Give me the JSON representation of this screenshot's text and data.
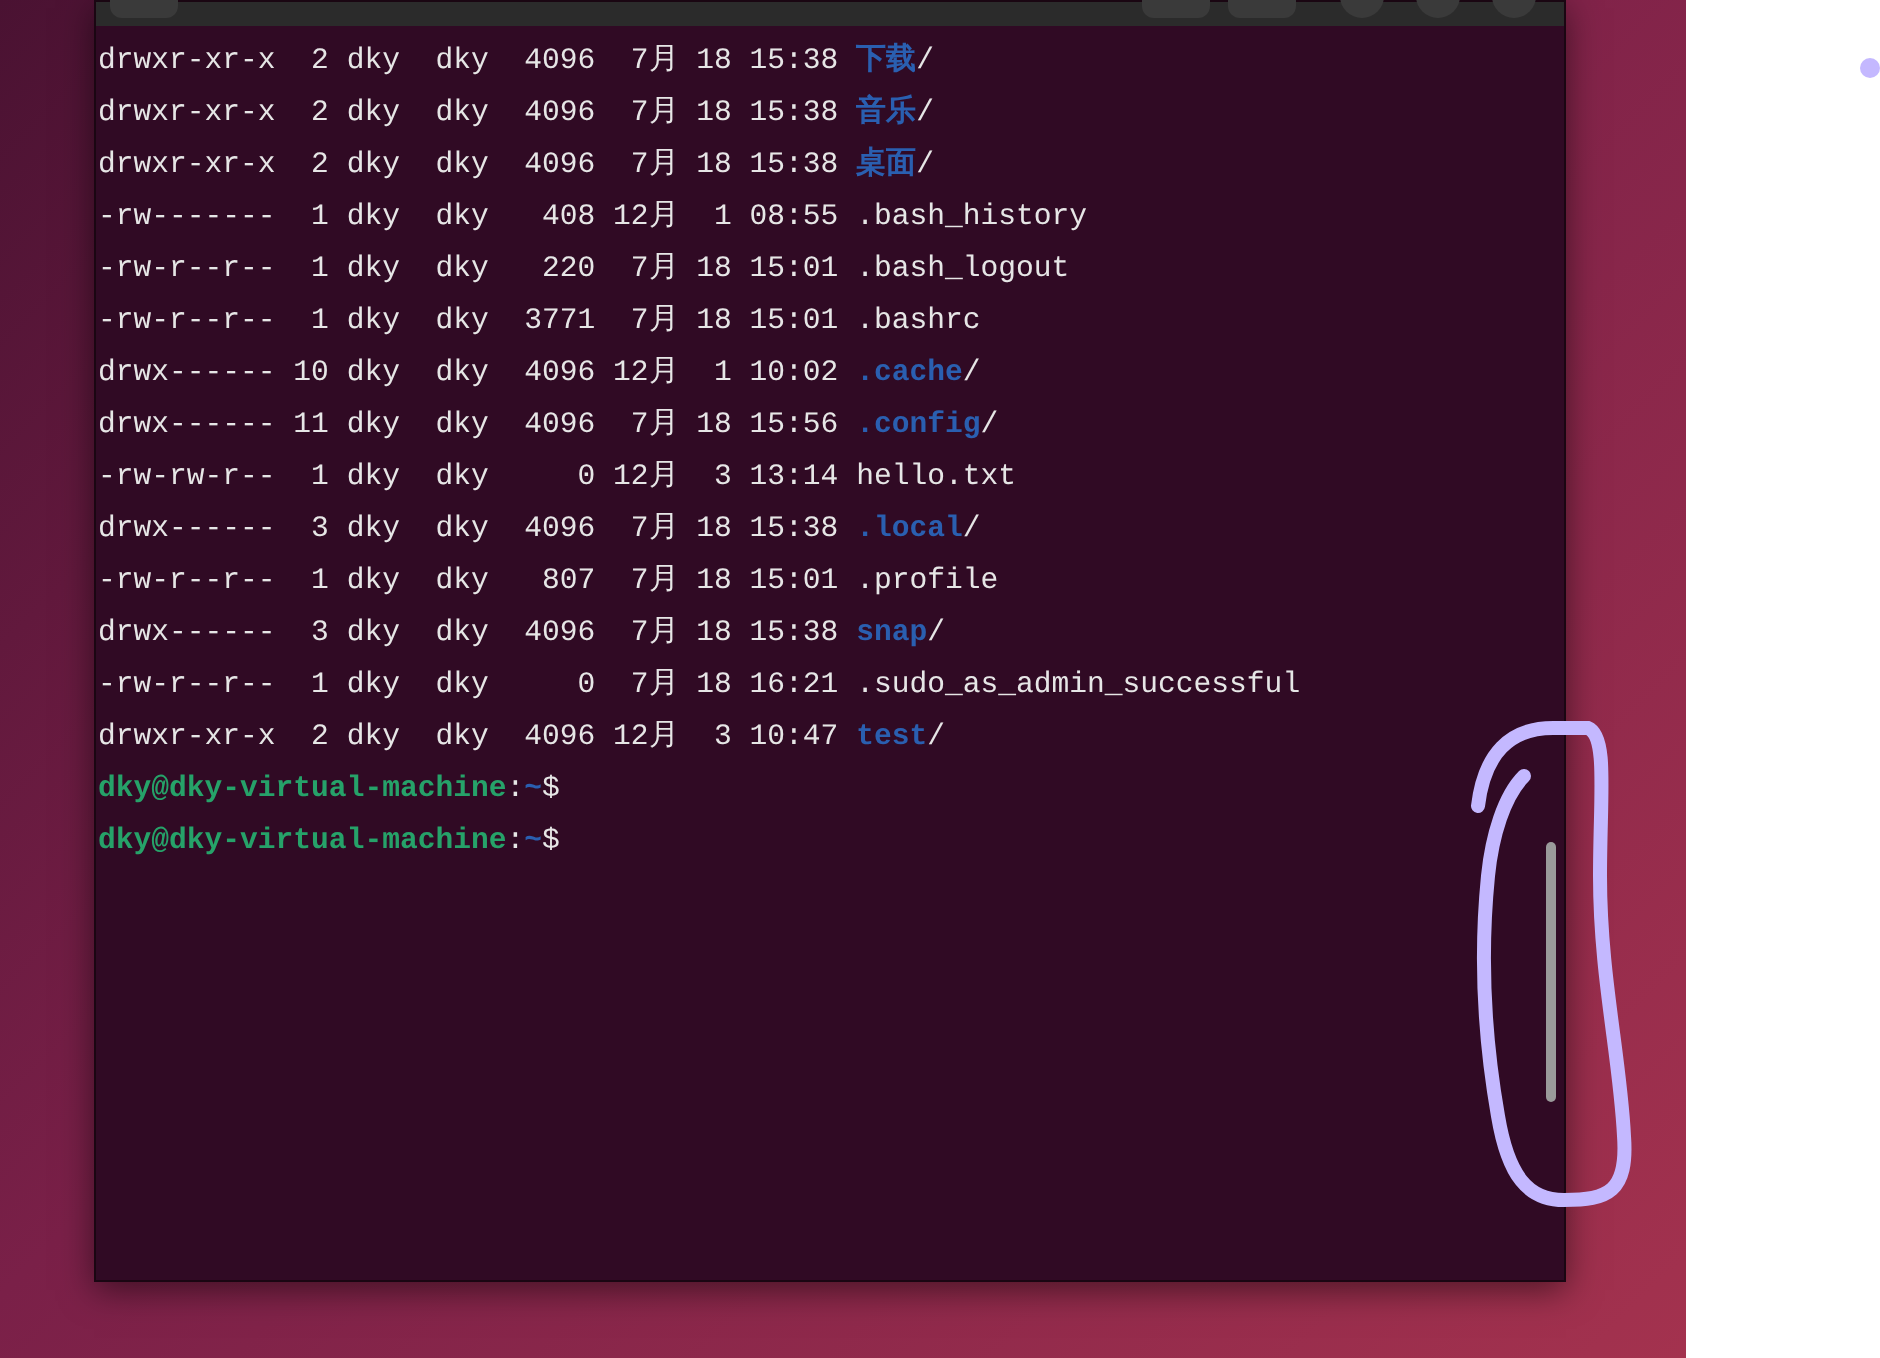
{
  "terminal": {
    "lines": [
      {
        "kind": "entry",
        "info": "drwxr-xr-x  2 dky  dky  4096  7月 18 15:38 ",
        "name": "下载",
        "directory": true,
        "suffix": "/"
      },
      {
        "kind": "entry",
        "info": "drwxr-xr-x  2 dky  dky  4096  7月 18 15:38 ",
        "name": "音乐",
        "directory": true,
        "suffix": "/"
      },
      {
        "kind": "entry",
        "info": "drwxr-xr-x  2 dky  dky  4096  7月 18 15:38 ",
        "name": "桌面",
        "directory": true,
        "suffix": "/"
      },
      {
        "kind": "entry",
        "info": "-rw-------  1 dky  dky   408 12月  1 08:55 ",
        "name": ".bash_history",
        "directory": false
      },
      {
        "kind": "entry",
        "info": "-rw-r--r--  1 dky  dky   220  7月 18 15:01 ",
        "name": ".bash_logout",
        "directory": false
      },
      {
        "kind": "entry",
        "info": "-rw-r--r--  1 dky  dky  3771  7月 18 15:01 ",
        "name": ".bashrc",
        "directory": false
      },
      {
        "kind": "entry",
        "info": "drwx------ 10 dky  dky  4096 12月  1 10:02 ",
        "name": ".cache",
        "directory": true,
        "suffix": "/"
      },
      {
        "kind": "entry",
        "info": "drwx------ 11 dky  dky  4096  7月 18 15:56 ",
        "name": ".config",
        "directory": true,
        "suffix": "/"
      },
      {
        "kind": "entry",
        "info": "-rw-rw-r--  1 dky  dky     0 12月  3 13:14 ",
        "name": "hello.txt",
        "directory": false
      },
      {
        "kind": "entry",
        "info": "drwx------  3 dky  dky  4096  7月 18 15:38 ",
        "name": ".local",
        "directory": true,
        "suffix": "/"
      },
      {
        "kind": "entry",
        "info": "-rw-r--r--  1 dky  dky   807  7月 18 15:01 ",
        "name": ".profile",
        "directory": false
      },
      {
        "kind": "entry",
        "info": "drwx------  3 dky  dky  4096  7月 18 15:38 ",
        "name": "snap",
        "directory": true,
        "suffix": "/"
      },
      {
        "kind": "entry",
        "info": "-rw-r--r--  1 dky  dky     0  7月 18 16:21 ",
        "name": ".sudo_as_admin_successful",
        "directory": false
      },
      {
        "kind": "entry",
        "info": "drwxr-xr-x  2 dky  dky  4096 12月  3 10:47 ",
        "name": "test",
        "directory": true,
        "suffix": "/"
      },
      {
        "kind": "prompt",
        "user_host": "dky@dky-virtual-machine",
        "sep": ":",
        "path": "~",
        "symbol": "$"
      },
      {
        "kind": "prompt",
        "user_host": "dky@dky-virtual-machine",
        "sep": ":",
        "path": "~",
        "symbol": "$"
      }
    ]
  }
}
